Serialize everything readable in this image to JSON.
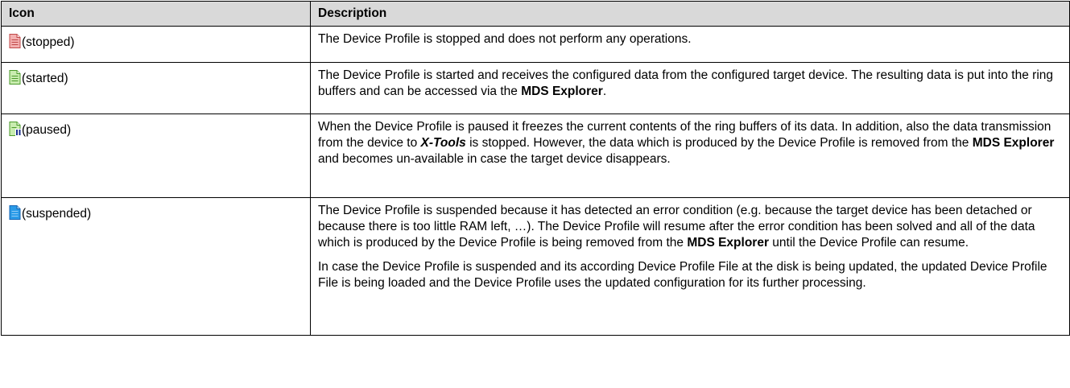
{
  "header": {
    "icon": "Icon",
    "description": "Description"
  },
  "rows": [
    {
      "icon_name": "device-profile-stopped-icon",
      "icon_color": "#e06868",
      "status": "(stopped)",
      "text": "The Device Profile is stopped and does not perform any operations."
    },
    {
      "icon_name": "device-profile-started-icon",
      "icon_color": "#6cc24a",
      "status": "(started)",
      "text1": "The Device Profile is started and receives the configured data from the configured target device. The resulting data is put into the ring buffers and can be accessed via the ",
      "bold1": "MDS Explorer",
      "text2": "."
    },
    {
      "icon_name": "device-profile-paused-icon",
      "icon_color": "#6cc24a",
      "status": "(paused)",
      "text1": "When the Device Profile is paused it freezes the current contents of the ring buffers of its data. In addition, also the data transmission from the device to ",
      "bolditalic1": "X-Tools",
      "text2": " is stopped. However, the data which is produced by the Device Profile is removed from the ",
      "bold1": "MDS Explorer",
      "text3": " and becomes un-available in case the target device disappears."
    },
    {
      "icon_name": "device-profile-suspended-icon",
      "icon_color": "#1e90e0",
      "status": "(suspended)",
      "p1_text1": "The Device Profile is suspended because it has detected an error condition (e.g. because the target device has been detached or because there is too little RAM left, …). The Device Profile will resume after the error condition has been solved and all of the data which is produced by the Device Profile is being removed from the ",
      "p1_bold1": "MDS Explorer",
      "p1_text2": " until the Device Profile can resume.",
      "p2": "In case the Device Profile is suspended and its according Device Profile File at the disk is being updated, the updated Device Profile File is being loaded and the Device Profile uses the updated configuration for its further processing."
    }
  ]
}
